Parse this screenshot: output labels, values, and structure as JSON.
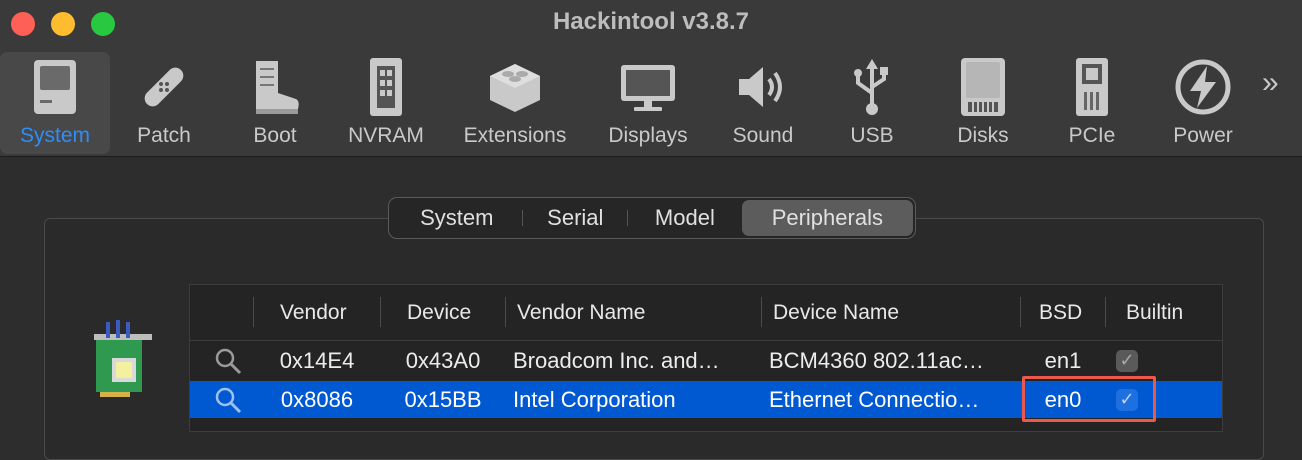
{
  "window": {
    "title": "Hackintool v3.8.7"
  },
  "toolbar": {
    "items": [
      {
        "label": "System",
        "icon": "computer-icon",
        "selected": true
      },
      {
        "label": "Patch",
        "icon": "bandage-icon"
      },
      {
        "label": "Boot",
        "icon": "boot-icon"
      },
      {
        "label": "NVRAM",
        "icon": "memory-chip-icon"
      },
      {
        "label": "Extensions",
        "icon": "lego-block-icon"
      },
      {
        "label": "Displays",
        "icon": "monitor-icon"
      },
      {
        "label": "Sound",
        "icon": "speaker-icon"
      },
      {
        "label": "USB",
        "icon": "usb-icon"
      },
      {
        "label": "Disks",
        "icon": "disk-icon"
      },
      {
        "label": "PCIe",
        "icon": "pcie-card-icon"
      },
      {
        "label": "Power",
        "icon": "power-bolt-icon"
      }
    ],
    "more": "»"
  },
  "tabs": [
    {
      "label": "System"
    },
    {
      "label": "Serial"
    },
    {
      "label": "Model"
    },
    {
      "label": "Peripherals",
      "active": true
    }
  ],
  "table": {
    "columns": [
      "",
      "Vendor",
      "Device",
      "Vendor Name",
      "Device Name",
      "BSD",
      "Builtin"
    ],
    "rows": [
      {
        "vendor": "0x14E4",
        "device": "0x43A0",
        "vendor_name": "Broadcom Inc. and…",
        "device_name": "BCM4360 802.11ac…",
        "bsd": "en1",
        "builtin": true,
        "selected": false
      },
      {
        "vendor": "0x8086",
        "device": "0x15BB",
        "vendor_name": "Intel Corporation",
        "device_name": "Ethernet Connectio…",
        "bsd": "en0",
        "builtin": true,
        "selected": true
      }
    ]
  },
  "colors": {
    "accent": "#2f8df6",
    "selection": "#0059d1",
    "highlight": "#e8594e"
  }
}
